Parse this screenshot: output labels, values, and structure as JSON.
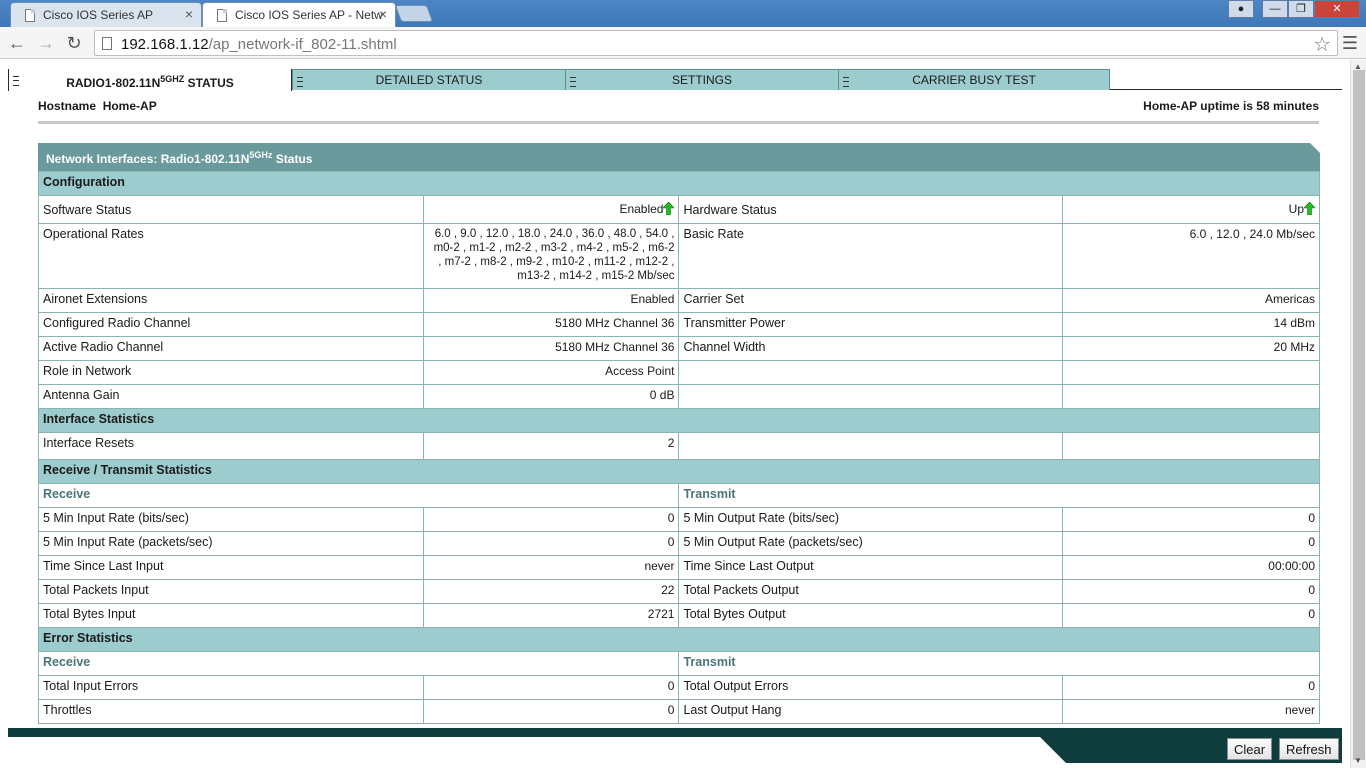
{
  "browser": {
    "tabs": [
      {
        "title": "Cisco IOS Series AP",
        "close": "×"
      },
      {
        "title": "Cisco IOS Series AP - Netw",
        "close": "×"
      }
    ],
    "url_host": "192.168.1.12",
    "url_path": "/ap_network-if_802-11.shtml",
    "window_buttons": [
      "minimize",
      "restore",
      "close"
    ]
  },
  "page_tabs": [
    {
      "label_pre": "RADIO1-802.11N",
      "label_sup": "5GHZ",
      "label_post": " STATUS"
    },
    {
      "label": "DETAILED STATUS"
    },
    {
      "label": "SETTINGS"
    },
    {
      "label": "CARRIER BUSY TEST"
    }
  ],
  "header": {
    "hostname_label": "Hostname",
    "hostname": "Home-AP",
    "uptime": "Home-AP uptime is 58 minutes"
  },
  "panel": {
    "title_pre": "Network Interfaces: Radio1-802.11N",
    "title_sup": "5GHz",
    "title_post": " Status"
  },
  "configuration": {
    "heading": "Configuration",
    "software_status_label": "Software Status",
    "software_status": "Enabled",
    "hardware_status_label": "Hardware Status",
    "hardware_status": "Up",
    "operational_rates_label": "Operational Rates",
    "operational_rates": "6.0 , 9.0 , 12.0 , 18.0 , 24.0 , 36.0 , 48.0 , 54.0 , m0-2 , m1-2 , m2-2 , m3-2 , m4-2 , m5-2 , m6-2 , m7-2 , m8-2 , m9-2 , m10-2 , m11-2 , m12-2 , m13-2 , m14-2 , m15-2 Mb/sec",
    "basic_rate_label": "Basic Rate",
    "basic_rate": "6.0 , 12.0 , 24.0 Mb/sec",
    "aironet_label": "Aironet Extensions",
    "aironet": "Enabled",
    "carrier_set_label": "Carrier Set",
    "carrier_set": "Americas",
    "configured_channel_label": "Configured Radio Channel",
    "configured_channel": "5180 MHz Channel 36",
    "tx_power_label": "Transmitter Power",
    "tx_power": "14 dBm",
    "active_channel_label": "Active Radio Channel",
    "active_channel": "5180 MHz Channel 36",
    "channel_width_label": "Channel Width",
    "channel_width": "20 MHz",
    "role_label": "Role in Network",
    "role": "Access Point",
    "antenna_gain_label": "Antenna Gain",
    "antenna_gain": "0 dB"
  },
  "interface_stats": {
    "heading": "Interface Statistics",
    "resets_label": "Interface Resets",
    "resets": "2"
  },
  "rxtx": {
    "heading": "Receive / Transmit Statistics",
    "receive": "Receive",
    "transmit": "Transmit",
    "rows": [
      {
        "rx_label": "5 Min Input Rate (bits/sec)",
        "rx": "0",
        "tx_label": "5 Min Output Rate (bits/sec)",
        "tx": "0"
      },
      {
        "rx_label": "5 Min Input Rate (packets/sec)",
        "rx": "0",
        "tx_label": "5 Min Output Rate (packets/sec)",
        "tx": "0"
      },
      {
        "rx_label": "Time Since Last Input",
        "rx": "never",
        "tx_label": "Time Since Last Output",
        "tx": "00:00:00"
      },
      {
        "rx_label": "Total Packets Input",
        "rx": "22",
        "tx_label": "Total Packets Output",
        "tx": "0"
      },
      {
        "rx_label": "Total Bytes Input",
        "rx": "2721",
        "tx_label": "Total Bytes Output",
        "tx": "0"
      }
    ]
  },
  "errors": {
    "heading": "Error Statistics",
    "receive": "Receive",
    "transmit": "Transmit",
    "rows": [
      {
        "rx_label": "Total Input Errors",
        "rx": "0",
        "tx_label": "Total Output Errors",
        "tx": "0"
      },
      {
        "rx_label": "Throttles",
        "rx": "0",
        "tx_label": "Last Output Hang",
        "tx": "never"
      }
    ]
  },
  "buttons": {
    "clear": "Clear",
    "refresh": "Refresh"
  },
  "colors": {
    "section_bg": "#9ccccd",
    "panel_title_bg": "#6a9a9c",
    "footer": "#0f3d3d",
    "status_arrow": "#22bb22"
  }
}
